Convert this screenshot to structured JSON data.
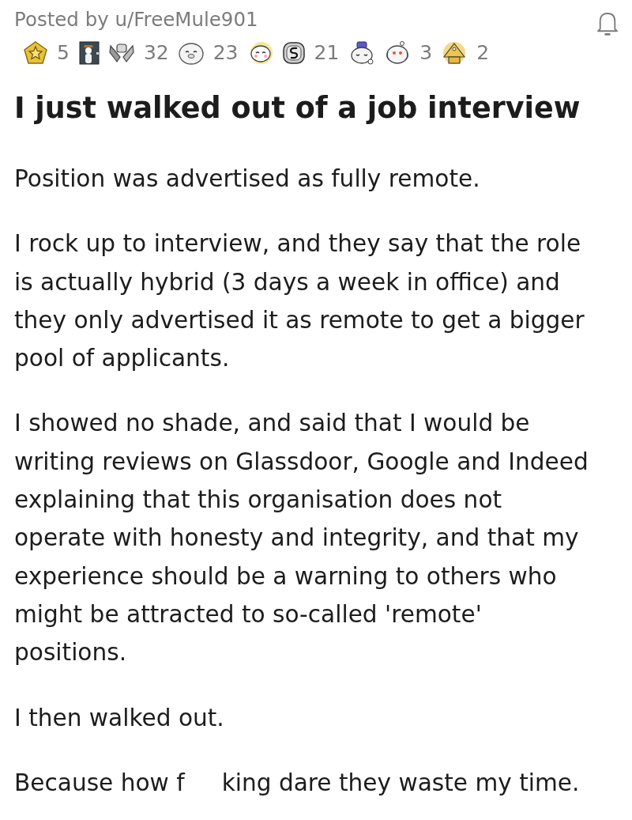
{
  "post": {
    "byline": "Posted by u/FreeMule901",
    "awards": [
      {
        "kind": "star-badge",
        "count": "5"
      },
      {
        "kind": "door"
      },
      {
        "kind": "handshake",
        "count": "32"
      },
      {
        "kind": "seal",
        "count": "23"
      },
      {
        "kind": "smiling-face"
      },
      {
        "kind": "coin",
        "count": "21"
      },
      {
        "kind": "hat-face"
      },
      {
        "kind": "peeking-face",
        "count": "3"
      },
      {
        "kind": "pyramid",
        "count": "2"
      }
    ],
    "title": "I just walked out of a job interview",
    "body": [
      "Position was advertised as fully remote.",
      "I rock up to interview, and they say that the role is actually hybrid (3 days a week in office) and they only advertised it as remote to get a bigger pool of applicants.",
      "I showed no shade, and said that I would be writing reviews on Glassdoor, Google and Indeed explaining that this organisation does not operate with honesty and integrity, and that my experience should be a warning to others who might be attracted to so-called 'remote' positions.",
      "I then walked out.",
      "Because how f     king dare they waste my time."
    ]
  }
}
